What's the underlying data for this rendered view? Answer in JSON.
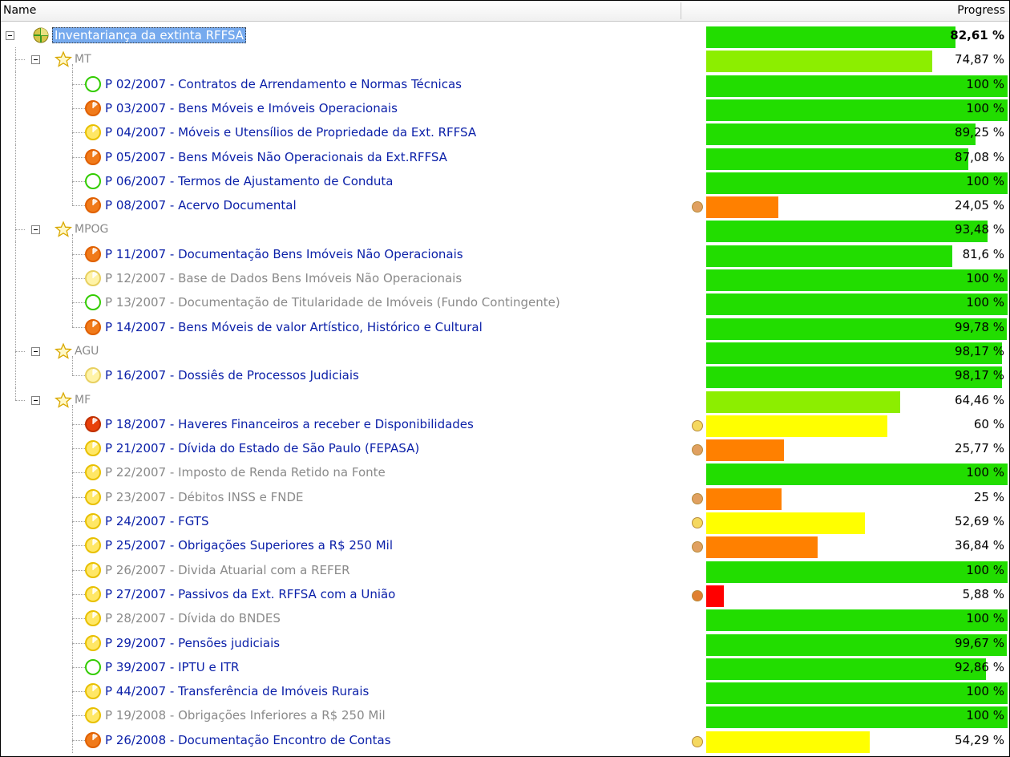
{
  "header": {
    "name_label": "Name",
    "progress_label": "Progress"
  },
  "colors": {
    "full_green": "#22dd00",
    "light_green": "#8cee00",
    "yellow": "#ffff00",
    "orange": "#ff8000",
    "red": "#ff0000",
    "link_blue": "#0a1fa8",
    "muted_gray": "#8a8a8a"
  },
  "rows": [
    {
      "level": 0,
      "kind": "root",
      "icon": "globe-icon",
      "label": "Inventariança da extinta RFFSA",
      "progress": 82.61,
      "progress_text": "82,61 %",
      "bar_color": "#22dd00",
      "bold": true,
      "last": false
    },
    {
      "level": 1,
      "kind": "group",
      "icon": "star-icon",
      "label": "MT",
      "progress": 74.87,
      "progress_text": "74,87 %",
      "bar_color": "#8cee00",
      "last": false
    },
    {
      "level": 2,
      "kind": "item",
      "status": "active",
      "icon": "clock-green-icon",
      "label": "P 02/2007 - Contratos de Arrendamento e Normas Técnicas",
      "progress": 100,
      "progress_text": "100 %",
      "bar_color": "#22dd00",
      "last": false
    },
    {
      "level": 2,
      "kind": "item",
      "status": "active",
      "icon": "clock-orange-icon",
      "label": "P 03/2007 - Bens Móveis e Imóveis Operacionais",
      "progress": 100,
      "progress_text": "100 %",
      "bar_color": "#22dd00",
      "last": false
    },
    {
      "level": 2,
      "kind": "item",
      "status": "active",
      "icon": "clock-yellow-icon",
      "label": "P 04/2007 - Móveis e Utensílios de Propriedade da Ext. RFFSA",
      "progress": 89.25,
      "progress_text": "89,25 %",
      "bar_color": "#22dd00",
      "last": false
    },
    {
      "level": 2,
      "kind": "item",
      "status": "active",
      "icon": "clock-orange-icon",
      "label": "P 05/2007 - Bens Móveis Não Operacionais da Ext.RFFSA",
      "progress": 87.08,
      "progress_text": "87,08 %",
      "bar_color": "#22dd00",
      "last": false
    },
    {
      "level": 2,
      "kind": "item",
      "status": "active",
      "icon": "clock-green-icon",
      "label": "P 06/2007 - Termos de Ajustamento de Conduta",
      "progress": 100,
      "progress_text": "100 %",
      "bar_color": "#22dd00",
      "last": false
    },
    {
      "level": 2,
      "kind": "item",
      "status": "active",
      "icon": "clock-orange-icon",
      "label": "P 08/2007 - Acervo Documental",
      "progress": 24.05,
      "progress_text": "24,05 %",
      "bar_color": "#ff8000",
      "warn": "#e0a060",
      "last": true
    },
    {
      "level": 1,
      "kind": "group",
      "icon": "star-icon",
      "label": "MPOG",
      "progress": 93.48,
      "progress_text": "93,48 %",
      "bar_color": "#22dd00",
      "last": false
    },
    {
      "level": 2,
      "kind": "item",
      "status": "active",
      "icon": "clock-orange-icon",
      "label": "P 11/2007 - Documentação Bens Imóveis Não Operacionais",
      "progress": 81.6,
      "progress_text": "81,6 %",
      "bar_color": "#22dd00",
      "last": false
    },
    {
      "level": 2,
      "kind": "item",
      "status": "inactive",
      "icon": "clock-pale-yellow-icon",
      "label": "P 12/2007 - Base de Dados Bens Imóveis Não Operacionais",
      "progress": 100,
      "progress_text": "100 %",
      "bar_color": "#22dd00",
      "last": false
    },
    {
      "level": 2,
      "kind": "item",
      "status": "inactive",
      "icon": "clock-green-icon",
      "label": "P 13/2007 - Documentação de Titularidade de Imóveis (Fundo Contingente)",
      "progress": 100,
      "progress_text": "100 %",
      "bar_color": "#22dd00",
      "last": false
    },
    {
      "level": 2,
      "kind": "item",
      "status": "active",
      "icon": "clock-orange-icon",
      "label": "P 14/2007 - Bens Móveis de valor Artístico, Histórico e Cultural",
      "progress": 99.78,
      "progress_text": "99,78 %",
      "bar_color": "#22dd00",
      "last": true
    },
    {
      "level": 1,
      "kind": "group",
      "icon": "star-icon",
      "label": "AGU",
      "progress": 98.17,
      "progress_text": "98,17 %",
      "bar_color": "#22dd00",
      "last": false
    },
    {
      "level": 2,
      "kind": "item",
      "status": "active",
      "icon": "clock-pale-yellow-icon",
      "label": "P 16/2007 - Dossiês de Processos Judiciais",
      "progress": 98.17,
      "progress_text": "98,17 %",
      "bar_color": "#22dd00",
      "last": true
    },
    {
      "level": 1,
      "kind": "group",
      "icon": "star-icon",
      "label": "MF",
      "progress": 64.46,
      "progress_text": "64,46 %",
      "bar_color": "#8cee00",
      "last": true
    },
    {
      "level": 2,
      "kind": "item",
      "status": "active",
      "icon": "clock-red-icon",
      "label": "P 18/2007 - Haveres Financeiros a receber e Disponibilidades",
      "progress": 60,
      "progress_text": "60 %",
      "bar_color": "#ffff00",
      "warn": "#f5d860",
      "last": false
    },
    {
      "level": 2,
      "kind": "item",
      "status": "active",
      "icon": "clock-yellow-icon",
      "label": "P  21/2007 - Dívida do Estado de São Paulo (FEPASA)",
      "progress": 25.77,
      "progress_text": "25,77 %",
      "bar_color": "#ff8000",
      "warn": "#e0a060",
      "last": false
    },
    {
      "level": 2,
      "kind": "item",
      "status": "inactive",
      "icon": "clock-yellow-icon",
      "label": "P 22/2007 - Imposto de Renda Retido na Fonte",
      "progress": 100,
      "progress_text": "100 %",
      "bar_color": "#22dd00",
      "last": false
    },
    {
      "level": 2,
      "kind": "item",
      "status": "inactive",
      "icon": "clock-yellow-icon",
      "label": "P 23/2007 - Débitos INSS e FNDE",
      "progress": 25,
      "progress_text": "25 %",
      "bar_color": "#ff8000",
      "warn": "#e0a060",
      "last": false
    },
    {
      "level": 2,
      "kind": "item",
      "status": "active",
      "icon": "clock-yellow-icon",
      "label": "P 24/2007 - FGTS",
      "progress": 52.69,
      "progress_text": "52,69 %",
      "bar_color": "#ffff00",
      "warn": "#f5d860",
      "last": false
    },
    {
      "level": 2,
      "kind": "item",
      "status": "active",
      "icon": "clock-yellow-icon",
      "label": "P 25/2007 - Obrigações Superiores a R$ 250 Mil",
      "progress": 36.84,
      "progress_text": "36,84 %",
      "bar_color": "#ff8000",
      "warn": "#e0a060",
      "last": false
    },
    {
      "level": 2,
      "kind": "item",
      "status": "inactive",
      "icon": "clock-yellow-icon",
      "label": "P 26/2007 - Divida Atuarial com a REFER",
      "progress": 100,
      "progress_text": "100 %",
      "bar_color": "#22dd00",
      "last": false
    },
    {
      "level": 2,
      "kind": "item",
      "status": "active",
      "icon": "clock-yellow-icon",
      "label": "P 27/2007 - Passivos da Ext. RFFSA com a União",
      "progress": 5.88,
      "progress_text": "5,88 %",
      "bar_color": "#ff0000",
      "warn": "#e08030",
      "last": false
    },
    {
      "level": 2,
      "kind": "item",
      "status": "inactive",
      "icon": "clock-yellow-icon",
      "label": "P 28/2007 - Dívida do BNDES",
      "progress": 100,
      "progress_text": "100 %",
      "bar_color": "#22dd00",
      "last": false
    },
    {
      "level": 2,
      "kind": "item",
      "status": "active",
      "icon": "clock-yellow-icon",
      "label": "P 29/2007 - Pensões judiciais",
      "progress": 99.67,
      "progress_text": "99,67 %",
      "bar_color": "#22dd00",
      "last": false
    },
    {
      "level": 2,
      "kind": "item",
      "status": "active",
      "icon": "clock-green-icon",
      "label": "P 39/2007 - IPTU e ITR",
      "progress": 92.86,
      "progress_text": "92,86 %",
      "bar_color": "#22dd00",
      "last": false
    },
    {
      "level": 2,
      "kind": "item",
      "status": "active",
      "icon": "clock-yellow-icon",
      "label": "P 44/2007 - Transferência de Imóveis Rurais",
      "progress": 100,
      "progress_text": "100 %",
      "bar_color": "#22dd00",
      "last": false
    },
    {
      "level": 2,
      "kind": "item",
      "status": "inactive",
      "icon": "clock-yellow-icon",
      "label": "P 19/2008 - Obrigações Inferiores a R$ 250 Mil",
      "progress": 100,
      "progress_text": "100 %",
      "bar_color": "#22dd00",
      "last": false
    },
    {
      "level": 2,
      "kind": "item",
      "status": "active",
      "icon": "clock-orange-icon",
      "label": "P 26/2008 - Documentação Encontro de Contas",
      "progress": 54.29,
      "progress_text": "54,29 %",
      "bar_color": "#ffff00",
      "warn": "#f5d860",
      "last": false
    }
  ]
}
